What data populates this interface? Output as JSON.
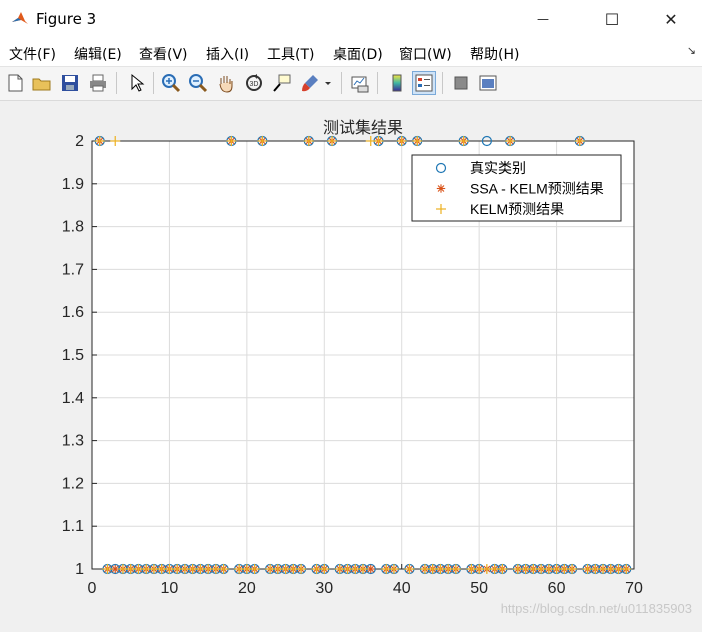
{
  "window": {
    "title": "Figure 3",
    "minimize_glyph": "—",
    "maximize_glyph": "☐",
    "close_glyph": "✕"
  },
  "menu": {
    "items": [
      "文件(F)",
      "编辑(E)",
      "查看(V)",
      "插入(I)",
      "工具(T)",
      "桌面(D)",
      "窗口(W)",
      "帮助(H)"
    ],
    "corner_glyph": "↘"
  },
  "toolbar": {
    "icons": [
      "new-figure-icon",
      "open-icon",
      "save-icon",
      "print-icon",
      "pointer-icon",
      "zoom-in-icon",
      "zoom-out-icon",
      "pan-hand-icon",
      "rotate-3d-icon",
      "data-cursor-icon",
      "brush-icon",
      "brush-dropdown-icon",
      "link-plot-icon",
      "colorbar-icon",
      "legend-icon",
      "hide-plot-tools-icon",
      "show-plot-tools-icon"
    ]
  },
  "colors": {
    "true_class": "#1f77b4",
    "ssa_kelm": "#d95319",
    "kelm": "#edb120",
    "grid": "#dcdcdc"
  },
  "chart_data": {
    "type": "scatter",
    "title": "测试集结果",
    "xlabel": "",
    "ylabel": "",
    "xlim": [
      0,
      70
    ],
    "ylim": [
      1,
      2
    ],
    "xticks": [
      0,
      10,
      20,
      30,
      40,
      50,
      60,
      70
    ],
    "yticks": [
      1,
      1.1,
      1.2,
      1.3,
      1.4,
      1.5,
      1.6,
      1.7,
      1.8,
      1.9,
      2
    ],
    "grid": true,
    "legend_position": "top-right",
    "series": [
      {
        "name": "真实类别",
        "marker": "circle",
        "x": [
          1,
          2,
          3,
          4,
          5,
          6,
          7,
          8,
          9,
          10,
          11,
          12,
          13,
          14,
          15,
          16,
          17,
          18,
          19,
          20,
          21,
          22,
          23,
          24,
          25,
          26,
          27,
          28,
          29,
          30,
          31,
          32,
          33,
          34,
          35,
          36,
          37,
          38,
          39,
          40,
          41,
          42,
          43,
          44,
          45,
          46,
          47,
          48,
          49,
          50,
          51,
          52,
          53,
          54,
          55,
          56,
          57,
          58,
          59,
          60,
          61,
          62,
          63,
          64,
          65,
          66,
          67,
          68,
          69
        ],
        "y": [
          2,
          1,
          1,
          1,
          1,
          1,
          1,
          1,
          1,
          1,
          1,
          1,
          1,
          1,
          1,
          1,
          1,
          2,
          1,
          1,
          1,
          2,
          1,
          1,
          1,
          1,
          1,
          2,
          1,
          1,
          2,
          1,
          1,
          1,
          1,
          1,
          2,
          1,
          1,
          2,
          1,
          2,
          1,
          1,
          1,
          1,
          1,
          2,
          1,
          1,
          2,
          1,
          1,
          2,
          1,
          1,
          1,
          1,
          1,
          1,
          1,
          1,
          2,
          1,
          1,
          1,
          1,
          1,
          1
        ]
      },
      {
        "name": "SSA - KELM预测结果",
        "marker": "asterisk",
        "x": [
          1,
          2,
          3,
          4,
          5,
          6,
          7,
          8,
          9,
          10,
          11,
          12,
          13,
          14,
          15,
          16,
          17,
          18,
          19,
          20,
          21,
          22,
          23,
          24,
          25,
          26,
          27,
          28,
          29,
          30,
          31,
          32,
          33,
          34,
          35,
          36,
          37,
          38,
          39,
          40,
          41,
          42,
          43,
          44,
          45,
          46,
          47,
          48,
          49,
          50,
          51,
          52,
          53,
          54,
          55,
          56,
          57,
          58,
          59,
          60,
          61,
          62,
          63,
          64,
          65,
          66,
          67,
          68,
          69
        ],
        "y": [
          2,
          1,
          1,
          1,
          1,
          1,
          1,
          1,
          1,
          1,
          1,
          1,
          1,
          1,
          1,
          1,
          1,
          2,
          1,
          1,
          1,
          2,
          1,
          1,
          1,
          1,
          1,
          2,
          1,
          1,
          2,
          1,
          1,
          1,
          1,
          1,
          2,
          1,
          1,
          2,
          1,
          2,
          1,
          1,
          1,
          1,
          1,
          2,
          1,
          1,
          1,
          1,
          1,
          2,
          1,
          1,
          1,
          1,
          1,
          1,
          1,
          1,
          2,
          1,
          1,
          1,
          1,
          1,
          1
        ]
      },
      {
        "name": "KELM预测结果",
        "marker": "plus",
        "x": [
          1,
          2,
          3,
          4,
          5,
          6,
          7,
          8,
          9,
          10,
          11,
          12,
          13,
          14,
          15,
          16,
          17,
          18,
          19,
          20,
          21,
          22,
          23,
          24,
          25,
          26,
          27,
          28,
          29,
          30,
          31,
          32,
          33,
          34,
          35,
          36,
          37,
          38,
          39,
          40,
          41,
          42,
          43,
          44,
          45,
          46,
          47,
          48,
          49,
          50,
          51,
          52,
          53,
          54,
          55,
          56,
          57,
          58,
          59,
          60,
          61,
          62,
          63,
          64,
          65,
          66,
          67,
          68,
          69
        ],
        "y": [
          2,
          1,
          2,
          1,
          1,
          1,
          1,
          1,
          1,
          1,
          1,
          1,
          1,
          1,
          1,
          1,
          1,
          2,
          1,
          1,
          1,
          2,
          1,
          1,
          1,
          1,
          1,
          2,
          1,
          1,
          2,
          1,
          1,
          1,
          1,
          2,
          2,
          1,
          1,
          2,
          1,
          2,
          1,
          1,
          1,
          1,
          1,
          2,
          1,
          1,
          1,
          1,
          1,
          2,
          1,
          1,
          1,
          1,
          1,
          1,
          1,
          1,
          2,
          1,
          1,
          1,
          1,
          1,
          1
        ]
      }
    ]
  },
  "watermark": "https://blog.csdn.net/u011835903"
}
